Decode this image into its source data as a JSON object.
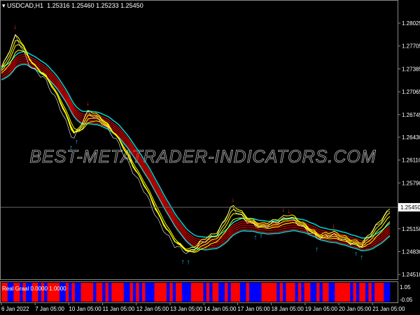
{
  "header": {
    "symbol": "USDCAD,H1",
    "ohlc": "1.25316 1.25460 1.25233 1.25450"
  },
  "indicator": {
    "label": "Real Graal 0.0000 1.0000",
    "levels": [
      "1.05",
      "-0.05"
    ],
    "segments": "RRBBRRBRBBRRBRBRRRRBBRBRBBRRRRBRRBRBRRRRBBRBRBRBBBRRRRBRBRRBBBRRRRBRBRRBBRBRRRBBRBBBBRRRRRBRBRRRBRBRRBBRBRRBBRRRRRBRBRRBRBRRRBB"
  },
  "watermark": "BEST-METATRADER-INDICATORS.COM",
  "colors": {
    "up_arrow": "#29b6f6",
    "down_arrow": "#ff2020",
    "band_slow": "#ff0000",
    "band_outer": "#00d4d4",
    "band_fast": "#ffff00",
    "ind_up": "#0000ff",
    "ind_down": "#ff0000"
  },
  "chart_data": {
    "type": "line",
    "price_axis": [
      "1.28025",
      "1.27705",
      "1.27385",
      "1.27065",
      "1.26745",
      "1.26430",
      "1.26110",
      "1.25790",
      "1.25150",
      "1.24830",
      "1.24510"
    ],
    "current_price": "1.25450",
    "time_axis": [
      "6 Jan 2022",
      "7 Jan 05:00",
      "10 Jan 05:00",
      "11 Jan 05:00",
      "12 Jan 05:00",
      "13 Jan 05:00",
      "14 Jan 05:00",
      "17 Jan 05:00",
      "18 Jan 05:00",
      "19 Jan 05:00",
      "20 Jan 05:00",
      "21 Jan 05:00"
    ],
    "ylim": [
      1.2435,
      1.2835
    ],
    "close": [
      1.27369,
      1.27859,
      1.27418,
      1.27252,
      1.2688,
      1.2639,
      1.26782,
      1.26635,
      1.2639,
      1.25998,
      1.25656,
      1.25215,
      1.24922,
      1.24804,
      1.24971,
      1.25069,
      1.2546,
      1.25264,
      1.25166,
      1.25235,
      1.25313,
      1.25166,
      1.25019,
      1.25069,
      1.24971,
      1.24902,
      1.25166,
      1.25411
    ]
  }
}
